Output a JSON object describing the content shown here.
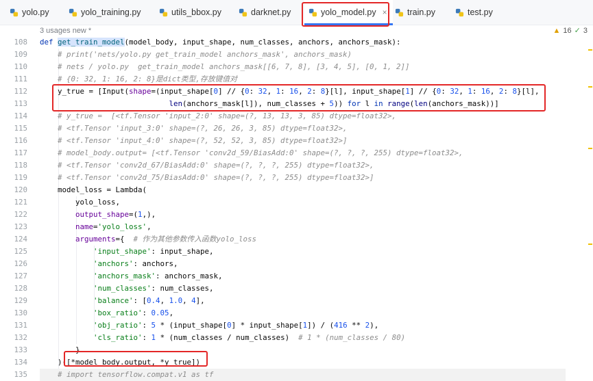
{
  "tabs": [
    {
      "label": "yolo.py",
      "icon": "python-file-icon"
    },
    {
      "label": "yolo_training.py",
      "icon": "python-file-icon"
    },
    {
      "label": "utils_bbox.py",
      "icon": "python-file-icon"
    },
    {
      "label": "darknet.py",
      "icon": "python-file-icon"
    },
    {
      "label": "yolo_model.py",
      "icon": "python-file-icon",
      "active": true,
      "close": "×"
    },
    {
      "label": "train.py",
      "icon": "python-file-icon"
    },
    {
      "label": "test.py",
      "icon": "python-file-icon"
    }
  ],
  "inlay_hint": "3 usages   new *",
  "inspections": {
    "warnings": "16",
    "weak_warnings": "3"
  },
  "line_numbers": [
    "108",
    "109",
    "110",
    "111",
    "112",
    "113",
    "114",
    "115",
    "116",
    "117",
    "118",
    "119",
    "120",
    "121",
    "122",
    "123",
    "124",
    "125",
    "126",
    "127",
    "128",
    "129",
    "130",
    "131",
    "132",
    "133",
    "134",
    "135"
  ],
  "code": {
    "l108": [
      "def ",
      "get_train_model",
      "(model_body, input_shape, num_classes, anchors, anchors_mask):"
    ],
    "l109": "    # print('nets/yolo.py get_train_model anchors_mask', anchors_mask)",
    "l110": "    # nets / yolo.py  get_train_model anchors_mask[[6, 7, 8], [3, 4, 5], [0, 1, 2]]",
    "l111": "    # {0: 32, 1: 16, 2: 8}是dict类型,存放键值对",
    "l112": [
      "    y_true = [Input(",
      "shape",
      "=(input_shape[",
      "0",
      "] // {",
      "0",
      ": ",
      "32",
      ", ",
      "1",
      ": ",
      "16",
      ", ",
      "2",
      ": ",
      "8",
      "}[l], input_shape[",
      "1",
      "] // {",
      "0",
      ": ",
      "32",
      ", ",
      "1",
      ": ",
      "16",
      ", ",
      "2",
      ": ",
      "8",
      "}[l],"
    ],
    "l113": [
      "                             ",
      "len",
      "(anchors_mask[l]), num_classes + ",
      "5",
      ")) ",
      "for",
      " l ",
      "in",
      " ",
      "range",
      "(",
      "len",
      "(anchors_mask))]"
    ],
    "l114": "    # y_true =  [<tf.Tensor 'input_2:0' shape=(?, 13, 13, 3, 85) dtype=float32>,",
    "l115": "    # <tf.Tensor 'input_3:0' shape=(?, 26, 26, 3, 85) dtype=float32>,",
    "l116": "    # <tf.Tensor 'input_4:0' shape=(?, 52, 52, 3, 85) dtype=float32>]",
    "l117": "    # model_body.output= [<tf.Tensor 'conv2d_59/BiasAdd:0' shape=(?, ?, ?, 255) dtype=float32>,",
    "l118": "    # <tf.Tensor 'conv2d_67/BiasAdd:0' shape=(?, ?, ?, 255) dtype=float32>,",
    "l119": "    # <tf.Tensor 'conv2d_75/BiasAdd:0' shape=(?, ?, ?, 255) dtype=float32>]",
    "l120": "    model_loss = Lambda(",
    "l121": "        yolo_loss,",
    "l122": [
      "        ",
      "output_shape",
      "=(",
      "1",
      ",),"
    ],
    "l123": [
      "        ",
      "name",
      "=",
      "'yolo_loss'",
      ","
    ],
    "l124": [
      "        ",
      "arguments",
      "={  ",
      "# 作为其他参数传入函数yolo_loss"
    ],
    "l125": [
      "            ",
      "'input_shape'",
      ": input_shape,"
    ],
    "l126": [
      "            ",
      "'anchors'",
      ": anchors,"
    ],
    "l127": [
      "            ",
      "'anchors_mask'",
      ": anchors_mask,"
    ],
    "l128": [
      "            ",
      "'num_classes'",
      ": num_classes,"
    ],
    "l129": [
      "            ",
      "'balance'",
      ": [",
      "0.4",
      ", ",
      "1.0",
      ", ",
      "4",
      "],"
    ],
    "l130": [
      "            ",
      "'box_ratio'",
      ": ",
      "0.05",
      ","
    ],
    "l131": [
      "            ",
      "'obj_ratio'",
      ": ",
      "5",
      " * (input_shape[",
      "0",
      "] * input_shape[",
      "1",
      "]) / (",
      "416",
      " ** ",
      "2",
      "),"
    ],
    "l132": [
      "            ",
      "'cls_ratio'",
      ": ",
      "1",
      " * (num_classes / num_classes)  ",
      "# 1 * (num_classes / 80)"
    ],
    "l133": "        }",
    "l134": "    )([*model_body.output, *y_true])",
    "l135": "    # import tensorflow.compat.v1 as tf"
  },
  "colors": {
    "keyword": "#0033b3",
    "comment": "#8c8c8c",
    "string": "#067d17",
    "number": "#1750eb",
    "param": "#660099",
    "highlight": "#e32626"
  }
}
